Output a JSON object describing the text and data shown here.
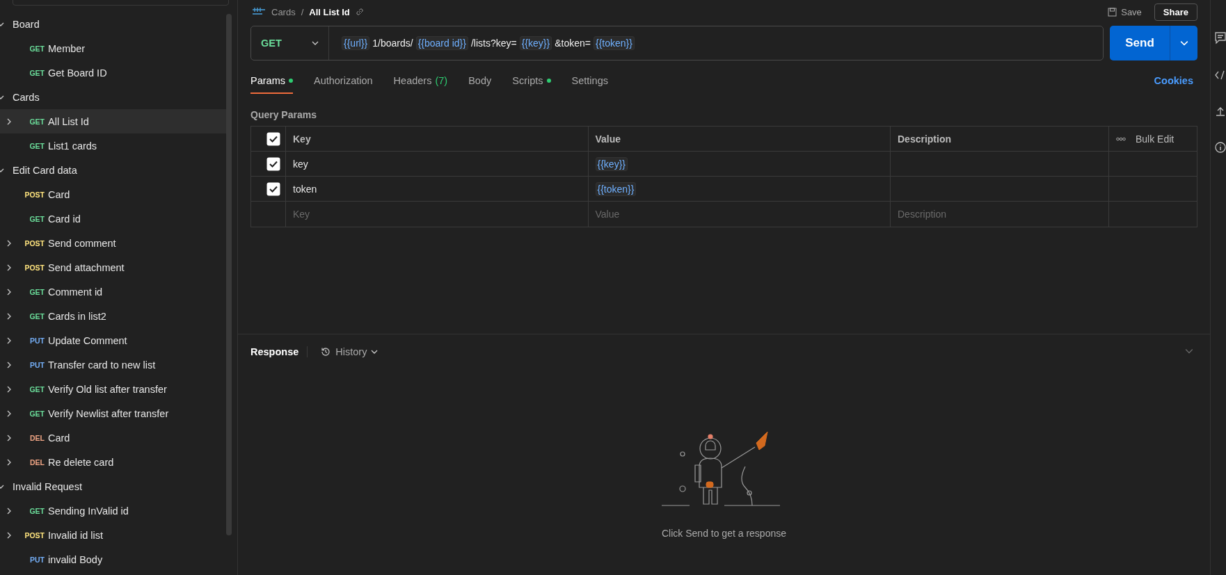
{
  "header": {
    "breadcrumb": [
      "Cards",
      "All List Id"
    ],
    "separator": "/",
    "save": "Save",
    "share": "Share"
  },
  "sidebar": {
    "groups": [
      {
        "name": "Board",
        "expanded": true,
        "children": [
          {
            "method": "GET",
            "color": "#6bdd9a",
            "name": "Member",
            "expandable": false,
            "selected": false
          },
          {
            "method": "GET",
            "color": "#6bdd9a",
            "name": "Get Board ID",
            "expandable": false,
            "selected": false
          }
        ]
      },
      {
        "name": "Cards",
        "expanded": true,
        "children": [
          {
            "method": "GET",
            "color": "#6bdd9a",
            "name": "All List Id",
            "expandable": true,
            "selected": true
          },
          {
            "method": "GET",
            "color": "#6bdd9a",
            "name": "List1 cards",
            "expandable": false,
            "selected": false
          }
        ]
      },
      {
        "name": "Edit Card data",
        "expanded": true,
        "children": [
          {
            "method": "POST",
            "color": "#ffe47e",
            "name": "Card",
            "expandable": false,
            "selected": false
          },
          {
            "method": "GET",
            "color": "#6bdd9a",
            "name": "Card id",
            "expandable": false,
            "selected": false
          },
          {
            "method": "POST",
            "color": "#ffe47e",
            "name": "Send comment",
            "expandable": true,
            "selected": false
          },
          {
            "method": "POST",
            "color": "#ffe47e",
            "name": "Send attachment",
            "expandable": true,
            "selected": false
          },
          {
            "method": "GET",
            "color": "#6bdd9a",
            "name": "Comment id",
            "expandable": true,
            "selected": false
          },
          {
            "method": "GET",
            "color": "#6bdd9a",
            "name": "Cards in list2",
            "expandable": true,
            "selected": false
          },
          {
            "method": "PUT",
            "color": "#74aef6",
            "name": "Update Comment",
            "expandable": true,
            "selected": false
          },
          {
            "method": "PUT",
            "color": "#74aef6",
            "name": "Transfer card to new list",
            "expandable": true,
            "selected": false
          },
          {
            "method": "GET",
            "color": "#6bdd9a",
            "name": "Verify Old list after transfer",
            "expandable": true,
            "selected": false
          },
          {
            "method": "GET",
            "color": "#6bdd9a",
            "name": "Verify Newlist after transfer",
            "expandable": true,
            "selected": false
          },
          {
            "method": "DEL",
            "color": "#f0a585",
            "name": "Card",
            "expandable": true,
            "selected": false
          },
          {
            "method": "DEL",
            "color": "#f0a585",
            "name": "Re delete card",
            "expandable": true,
            "selected": false
          }
        ]
      },
      {
        "name": "Invalid Request",
        "expanded": true,
        "children": [
          {
            "method": "GET",
            "color": "#6bdd9a",
            "name": "Sending InValid id",
            "expandable": true,
            "selected": false
          },
          {
            "method": "POST",
            "color": "#ffe47e",
            "name": "Invalid id list",
            "expandable": true,
            "selected": false
          },
          {
            "method": "PUT",
            "color": "#74aef6",
            "name": "invalid Body",
            "expandable": false,
            "selected": false
          }
        ]
      }
    ]
  },
  "request": {
    "method": "GET",
    "color": "#6bdd9a",
    "url": [
      {
        "kind": "variable",
        "text": "{{url}}"
      },
      {
        "kind": "text",
        "text": "1/boards/"
      },
      {
        "kind": "variable",
        "text": "{{board id}}"
      },
      {
        "kind": "text",
        "text": "/lists?key="
      },
      {
        "kind": "variable",
        "text": "{{key}}"
      },
      {
        "kind": "text",
        "text": "&token="
      },
      {
        "kind": "variable",
        "text": "{{token}}"
      }
    ],
    "send": "Send"
  },
  "tabs": [
    {
      "label": "Params",
      "selected": true,
      "indicator": true
    },
    {
      "label": "Authorization",
      "selected": false,
      "indicator": false
    },
    {
      "label": "Headers",
      "count": "(7)",
      "selected": false,
      "indicator": false
    },
    {
      "label": "Body",
      "selected": false,
      "indicator": false
    },
    {
      "label": "Scripts",
      "selected": false,
      "indicator": true
    },
    {
      "label": "Settings",
      "selected": false,
      "indicator": false
    }
  ],
  "cookies": "Cookies",
  "query_params": {
    "title": "Query Params",
    "all_checked": true,
    "columns": [
      "Key",
      "Value",
      "Description"
    ],
    "bulk_edit": "Bulk Edit",
    "rows": [
      {
        "checked": true,
        "key": "key",
        "value": "{{key}}"
      },
      {
        "checked": true,
        "key": "token",
        "value": "{{token}}"
      }
    ],
    "placeholders": {
      "key": "Key",
      "value": "Value",
      "description": "Description"
    }
  },
  "response": {
    "title": "Response",
    "history": "History",
    "empty_message": "Click Send to get a response"
  }
}
